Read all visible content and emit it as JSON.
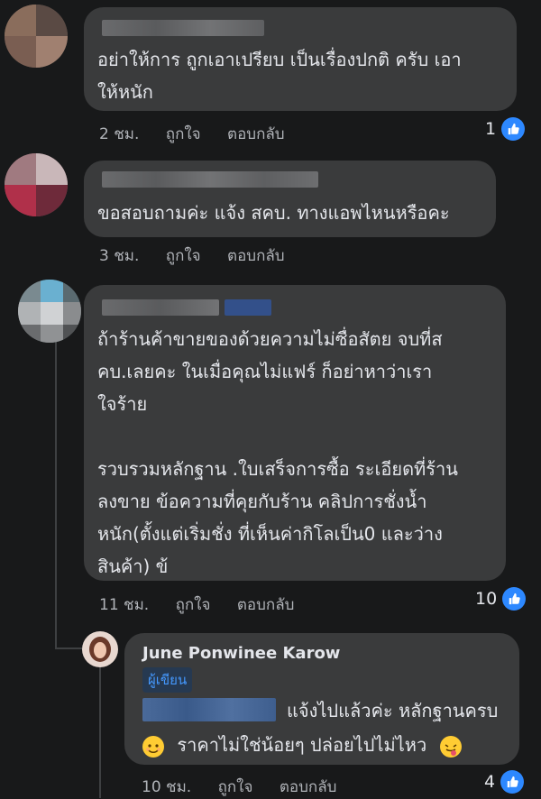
{
  "comments": [
    {
      "text": "อย่าให้การ ถูกเอาเปรียบ เป็นเรื่องปกติ ครับ เอา\nให้หนัก",
      "time": "2 ชม.",
      "like_label": "ถูกใจ",
      "reply_label": "ตอบกลับ",
      "reaction_count": "1",
      "reaction_icon": "like-icon"
    },
    {
      "text": "ขอสอบถามค่ะ แจ้ง สคบ. ทางแอพไหนหรือคะ",
      "time": "3 ชม.",
      "like_label": "ถูกใจ",
      "reply_label": "ตอบกลับ",
      "reaction_count": ""
    },
    {
      "text": "ถ้าร้านค้าขายของด้วยความไม่ซื่อสัตย จบที่ส\nคบ.เลยคะ ในเมื่อคุณไม่แฟร์ ก็อย่าหาว่าเรา\nใจร้าย\n\nรวบรวมหลักฐาน .ใบเสร็จการซื้อ ระเอียดที่ร้าน\nลงขาย ข้อความที่คุยกับร้าน คลิปการชั่งน้ำ\nหนัก(ตั้งแต่เริ่มชั่ง ที่เห็นค่ากิโลเป็น0 และว่าง\nสินค้า) ข้",
      "time": "11 ชม.",
      "like_label": "ถูกใจ",
      "reply_label": "ตอบกลับ",
      "reaction_count": "10",
      "reaction_icon": "like-icon"
    }
  ],
  "reply": {
    "author": "June Ponwinee Karow",
    "badge": "ผู้เขียน",
    "line1": "แจ้งไปแล้วค่ะ หลักฐานครบ",
    "line2": "ราคาไม่ใช่น้อยๆ ปล่อยไปไม่ไหว",
    "time": "10 ชม.",
    "like_label": "ถูกใจ",
    "reply_label": "ตอบกลับ",
    "reaction_count": "4",
    "reaction_icon": "like-icon"
  },
  "colors": {
    "background": "#18191a",
    "bubble": "#3a3b3c",
    "accent": "#2d88ff",
    "muted_text": "#b0b3b8"
  }
}
